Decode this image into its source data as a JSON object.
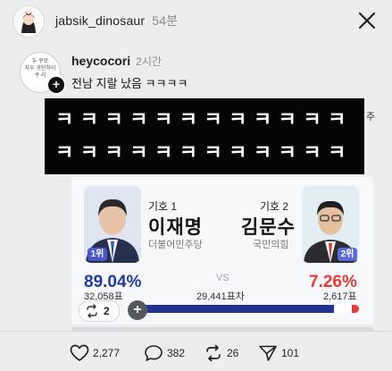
{
  "header": {
    "username": "jabsik_dinosaur",
    "time": "54분"
  },
  "post": {
    "handle": "heycocori",
    "time": "2시간",
    "avatar_text": "두 쿠로\n자우 귀탄하이\n쿠 리",
    "text": "전남 지랄 났음 ㅋㅋㅋㅋ",
    "laugh_row_1": "ㅋㅋㅋㅋㅋㅋㅋㅋㅋㅋㅋㅋ",
    "laugh_row_2": "ㅋㅋㅋㅋㅋㅋㅋㅋㅋㅋㅋㅋ",
    "side_char": "주"
  },
  "election": {
    "left": {
      "number_label": "기호 1",
      "name": "이재명",
      "party": "더불어민주당",
      "rank": "1위",
      "percent": "89.04%",
      "votes": "32,058표",
      "color": "#1f3c9a"
    },
    "right": {
      "number_label": "기호 2",
      "name": "김문수",
      "party": "국민의힘",
      "rank": "2위",
      "percent": "7.26%",
      "votes": "2,617표",
      "color": "#e23b3b"
    },
    "vs_label": "VS",
    "difference": "29,441표차",
    "share_left": 89.04,
    "share_right": 7.26
  },
  "card_controls": {
    "repost_count": "2"
  },
  "actions": {
    "likes": "2,277",
    "comments": "382",
    "reposts": "26",
    "shares": "101"
  }
}
